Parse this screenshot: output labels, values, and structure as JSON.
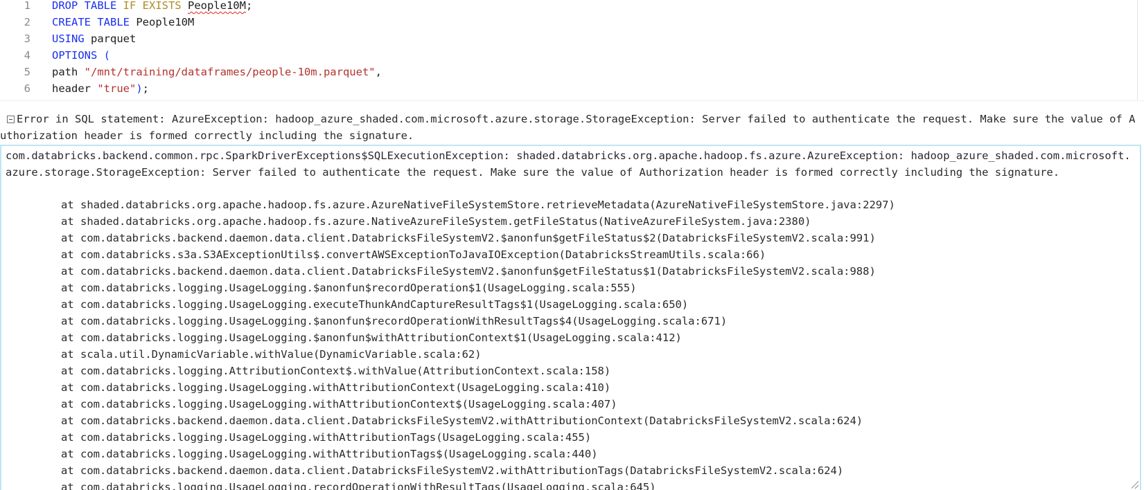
{
  "editor": {
    "lines": [
      {
        "num": "1",
        "parts": [
          [
            "kw",
            "DROP TABLE "
          ],
          [
            "kw2",
            "IF EXISTS "
          ],
          [
            "squiggle",
            "People10M"
          ],
          [
            "plain",
            ";"
          ]
        ]
      },
      {
        "num": "2",
        "parts": [
          [
            "kw",
            "CREATE TABLE "
          ],
          [
            "plain",
            "People10M"
          ]
        ]
      },
      {
        "num": "3",
        "parts": [
          [
            "kw",
            "USING "
          ],
          [
            "plain",
            "parquet"
          ]
        ]
      },
      {
        "num": "4",
        "parts": [
          [
            "kw",
            "OPTIONS ("
          ]
        ]
      },
      {
        "num": "5",
        "parts": [
          [
            "plain",
            "path "
          ],
          [
            "str",
            "\"/mnt/training/dataframes/people-10m.parquet\""
          ],
          [
            "plain",
            ","
          ]
        ]
      },
      {
        "num": "6",
        "parts": [
          [
            "plain",
            "header "
          ],
          [
            "str",
            "\"true\""
          ],
          [
            "kw",
            ")"
          ],
          [
            "plain",
            ";"
          ]
        ]
      }
    ]
  },
  "error": {
    "summary": "Error in SQL statement: AzureException: hadoop_azure_shaded.com.microsoft.azure.storage.StorageException: Server failed to authenticate the request. Make sure the value of Authorization header is formed correctly including the signature.",
    "exception": "com.databricks.backend.common.rpc.SparkDriverExceptions$SQLExecutionException: shaded.databricks.org.apache.hadoop.fs.azure.AzureException: hadoop_azure_shaded.com.microsoft.azure.storage.StorageException: Server failed to authenticate the request. Make sure the value of Authorization header is formed correctly including the signature.",
    "frames": [
      "at shaded.databricks.org.apache.hadoop.fs.azure.AzureNativeFileSystemStore.retrieveMetadata(AzureNativeFileSystemStore.java:2297)",
      "at shaded.databricks.org.apache.hadoop.fs.azure.NativeAzureFileSystem.getFileStatus(NativeAzureFileSystem.java:2380)",
      "at com.databricks.backend.daemon.data.client.DatabricksFileSystemV2.$anonfun$getFileStatus$2(DatabricksFileSystemV2.scala:991)",
      "at com.databricks.s3a.S3AExceptionUtils$.convertAWSExceptionToJavaIOException(DatabricksStreamUtils.scala:66)",
      "at com.databricks.backend.daemon.data.client.DatabricksFileSystemV2.$anonfun$getFileStatus$1(DatabricksFileSystemV2.scala:988)",
      "at com.databricks.logging.UsageLogging.$anonfun$recordOperation$1(UsageLogging.scala:555)",
      "at com.databricks.logging.UsageLogging.executeThunkAndCaptureResultTags$1(UsageLogging.scala:650)",
      "at com.databricks.logging.UsageLogging.$anonfun$recordOperationWithResultTags$4(UsageLogging.scala:671)",
      "at com.databricks.logging.UsageLogging.$anonfun$withAttributionContext$1(UsageLogging.scala:412)",
      "at scala.util.DynamicVariable.withValue(DynamicVariable.scala:62)",
      "at com.databricks.logging.AttributionContext$.withValue(AttributionContext.scala:158)",
      "at com.databricks.logging.UsageLogging.withAttributionContext(UsageLogging.scala:410)",
      "at com.databricks.logging.UsageLogging.withAttributionContext$(UsageLogging.scala:407)",
      "at com.databricks.backend.daemon.data.client.DatabricksFileSystemV2.withAttributionContext(DatabricksFileSystemV2.scala:624)",
      "at com.databricks.logging.UsageLogging.withAttributionTags(UsageLogging.scala:455)",
      "at com.databricks.logging.UsageLogging.withAttributionTags$(UsageLogging.scala:440)",
      "at com.databricks.backend.daemon.data.client.DatabricksFileSystemV2.withAttributionTags(DatabricksFileSystemV2.scala:624)",
      "at com.databricks.logging.UsageLogging.recordOperationWithResultTags(UsageLogging.scala:645)"
    ]
  },
  "icons": {
    "collapse": "collapse-minus-icon",
    "resize": "resize-handle-icon"
  },
  "colors": {
    "keyword": "#1a2ff2",
    "keyword_secondary": "#b08a2a",
    "string": "#b3332d",
    "error_border": "#bfe6f4",
    "squiggle": "#e2231a"
  }
}
